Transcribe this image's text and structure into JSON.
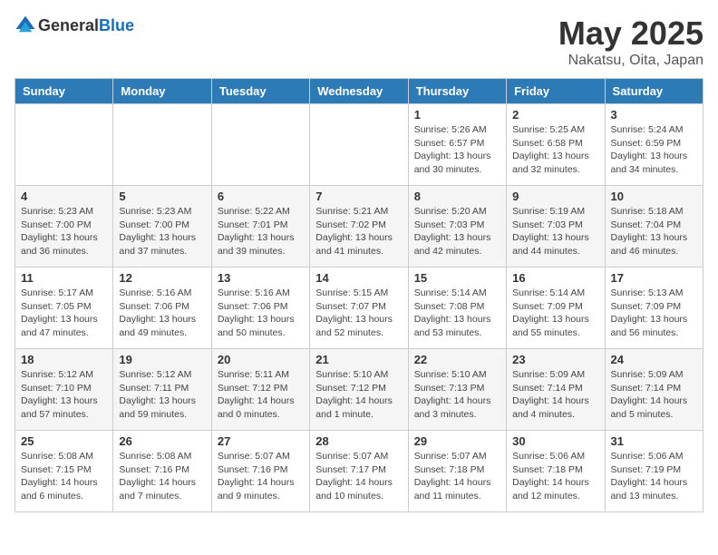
{
  "header": {
    "logo_general": "General",
    "logo_blue": "Blue",
    "month_title": "May 2025",
    "location": "Nakatsu, Oita, Japan"
  },
  "weekdays": [
    "Sunday",
    "Monday",
    "Tuesday",
    "Wednesday",
    "Thursday",
    "Friday",
    "Saturday"
  ],
  "weeks": [
    [
      {
        "day": "",
        "info": ""
      },
      {
        "day": "",
        "info": ""
      },
      {
        "day": "",
        "info": ""
      },
      {
        "day": "",
        "info": ""
      },
      {
        "day": "1",
        "info": "Sunrise: 5:26 AM\nSunset: 6:57 PM\nDaylight: 13 hours\nand 30 minutes."
      },
      {
        "day": "2",
        "info": "Sunrise: 5:25 AM\nSunset: 6:58 PM\nDaylight: 13 hours\nand 32 minutes."
      },
      {
        "day": "3",
        "info": "Sunrise: 5:24 AM\nSunset: 6:59 PM\nDaylight: 13 hours\nand 34 minutes."
      }
    ],
    [
      {
        "day": "4",
        "info": "Sunrise: 5:23 AM\nSunset: 7:00 PM\nDaylight: 13 hours\nand 36 minutes."
      },
      {
        "day": "5",
        "info": "Sunrise: 5:23 AM\nSunset: 7:00 PM\nDaylight: 13 hours\nand 37 minutes."
      },
      {
        "day": "6",
        "info": "Sunrise: 5:22 AM\nSunset: 7:01 PM\nDaylight: 13 hours\nand 39 minutes."
      },
      {
        "day": "7",
        "info": "Sunrise: 5:21 AM\nSunset: 7:02 PM\nDaylight: 13 hours\nand 41 minutes."
      },
      {
        "day": "8",
        "info": "Sunrise: 5:20 AM\nSunset: 7:03 PM\nDaylight: 13 hours\nand 42 minutes."
      },
      {
        "day": "9",
        "info": "Sunrise: 5:19 AM\nSunset: 7:03 PM\nDaylight: 13 hours\nand 44 minutes."
      },
      {
        "day": "10",
        "info": "Sunrise: 5:18 AM\nSunset: 7:04 PM\nDaylight: 13 hours\nand 46 minutes."
      }
    ],
    [
      {
        "day": "11",
        "info": "Sunrise: 5:17 AM\nSunset: 7:05 PM\nDaylight: 13 hours\nand 47 minutes."
      },
      {
        "day": "12",
        "info": "Sunrise: 5:16 AM\nSunset: 7:06 PM\nDaylight: 13 hours\nand 49 minutes."
      },
      {
        "day": "13",
        "info": "Sunrise: 5:16 AM\nSunset: 7:06 PM\nDaylight: 13 hours\nand 50 minutes."
      },
      {
        "day": "14",
        "info": "Sunrise: 5:15 AM\nSunset: 7:07 PM\nDaylight: 13 hours\nand 52 minutes."
      },
      {
        "day": "15",
        "info": "Sunrise: 5:14 AM\nSunset: 7:08 PM\nDaylight: 13 hours\nand 53 minutes."
      },
      {
        "day": "16",
        "info": "Sunrise: 5:14 AM\nSunset: 7:09 PM\nDaylight: 13 hours\nand 55 minutes."
      },
      {
        "day": "17",
        "info": "Sunrise: 5:13 AM\nSunset: 7:09 PM\nDaylight: 13 hours\nand 56 minutes."
      }
    ],
    [
      {
        "day": "18",
        "info": "Sunrise: 5:12 AM\nSunset: 7:10 PM\nDaylight: 13 hours\nand 57 minutes."
      },
      {
        "day": "19",
        "info": "Sunrise: 5:12 AM\nSunset: 7:11 PM\nDaylight: 13 hours\nand 59 minutes."
      },
      {
        "day": "20",
        "info": "Sunrise: 5:11 AM\nSunset: 7:12 PM\nDaylight: 14 hours\nand 0 minutes."
      },
      {
        "day": "21",
        "info": "Sunrise: 5:10 AM\nSunset: 7:12 PM\nDaylight: 14 hours\nand 1 minute."
      },
      {
        "day": "22",
        "info": "Sunrise: 5:10 AM\nSunset: 7:13 PM\nDaylight: 14 hours\nand 3 minutes."
      },
      {
        "day": "23",
        "info": "Sunrise: 5:09 AM\nSunset: 7:14 PM\nDaylight: 14 hours\nand 4 minutes."
      },
      {
        "day": "24",
        "info": "Sunrise: 5:09 AM\nSunset: 7:14 PM\nDaylight: 14 hours\nand 5 minutes."
      }
    ],
    [
      {
        "day": "25",
        "info": "Sunrise: 5:08 AM\nSunset: 7:15 PM\nDaylight: 14 hours\nand 6 minutes."
      },
      {
        "day": "26",
        "info": "Sunrise: 5:08 AM\nSunset: 7:16 PM\nDaylight: 14 hours\nand 7 minutes."
      },
      {
        "day": "27",
        "info": "Sunrise: 5:07 AM\nSunset: 7:16 PM\nDaylight: 14 hours\nand 9 minutes."
      },
      {
        "day": "28",
        "info": "Sunrise: 5:07 AM\nSunset: 7:17 PM\nDaylight: 14 hours\nand 10 minutes."
      },
      {
        "day": "29",
        "info": "Sunrise: 5:07 AM\nSunset: 7:18 PM\nDaylight: 14 hours\nand 11 minutes."
      },
      {
        "day": "30",
        "info": "Sunrise: 5:06 AM\nSunset: 7:18 PM\nDaylight: 14 hours\nand 12 minutes."
      },
      {
        "day": "31",
        "info": "Sunrise: 5:06 AM\nSunset: 7:19 PM\nDaylight: 14 hours\nand 13 minutes."
      }
    ]
  ]
}
